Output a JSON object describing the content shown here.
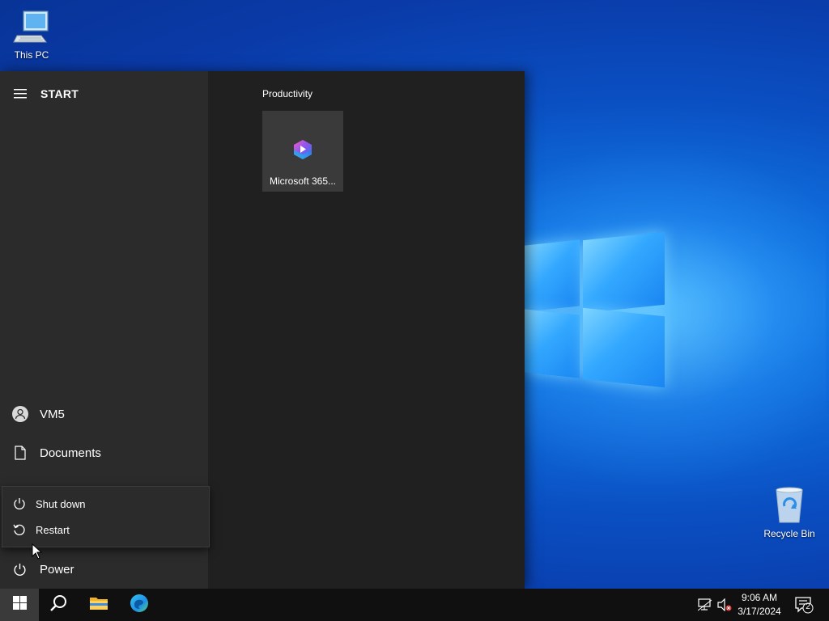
{
  "desktop": {
    "icons": [
      {
        "label": "This PC",
        "icon": "this-pc-icon"
      },
      {
        "label": "Recycle Bin",
        "icon": "recycle-bin-icon"
      }
    ]
  },
  "start_menu": {
    "title": "START",
    "user": {
      "label": "VM5",
      "icon": "user-avatar-icon"
    },
    "documents": {
      "label": "Documents",
      "icon": "document-icon"
    },
    "power_menu": {
      "items": [
        {
          "label": "Shut down",
          "icon": "power-icon"
        },
        {
          "label": "Restart",
          "icon": "restart-icon"
        }
      ]
    },
    "power": {
      "label": "Power",
      "icon": "power-icon"
    },
    "tiles": {
      "group_label": "Productivity",
      "items": [
        {
          "label": "Microsoft 365...",
          "icon": "microsoft-365-icon"
        }
      ]
    }
  },
  "taskbar": {
    "apps": [
      {
        "name": "start",
        "icon": "windows-logo-icon"
      },
      {
        "name": "search",
        "icon": "search-icon"
      },
      {
        "name": "file-explorer",
        "icon": "folder-icon"
      },
      {
        "name": "edge",
        "icon": "edge-icon"
      }
    ],
    "tray": {
      "time": "9:06 AM",
      "date": "3/17/2024",
      "notification_count": "2",
      "icons": [
        "network-icon",
        "volume-muted-icon",
        "notification-center-icon"
      ]
    }
  },
  "colors": {
    "desktop_blue": "#0a4fc2",
    "start_bg": "#202020",
    "start_left_bg": "#2b2b2b",
    "tile_bg": "#3a3a3a",
    "taskbar_bg": "#101010"
  }
}
